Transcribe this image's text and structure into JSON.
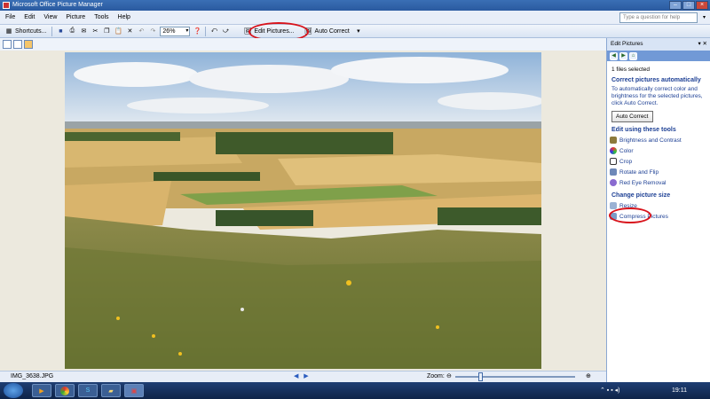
{
  "window": {
    "title": "Microsoft Office Picture Manager",
    "buttons": [
      "–",
      "□",
      "×"
    ]
  },
  "menu": {
    "items": [
      "File",
      "Edit",
      "View",
      "Picture",
      "Tools",
      "Help"
    ],
    "help_placeholder": "Type a question for help"
  },
  "toolbar": {
    "shortcuts_label": "Shortcuts...",
    "zoom_value": "26%",
    "edit_pictures_label": "Edit Pictures...",
    "auto_correct_label": "Auto Correct"
  },
  "status": {
    "filename": "IMG_3638.JPG",
    "zoom_label": "Zoom:",
    "zoom_fraction": 0.2
  },
  "task_pane": {
    "title": "Edit Pictures",
    "files_selected": "1 files selected",
    "correct_heading": "Correct pictures automatically",
    "correct_desc": "To automatically correct color and brightness for the selected pictures, click Auto Correct.",
    "auto_correct_button": "Auto Correct",
    "tools_heading": "Edit using these tools",
    "tools": [
      "Brightness and Contrast",
      "Color",
      "Crop",
      "Rotate and Flip",
      "Red Eye Removal"
    ],
    "size_heading": "Change picture size",
    "size_tools": [
      "Resize",
      "Compress Pictures"
    ]
  },
  "taskbar": {
    "clock": "19:11"
  },
  "colors": {
    "highlight": "#d8131b",
    "link": "#1c3f94"
  }
}
